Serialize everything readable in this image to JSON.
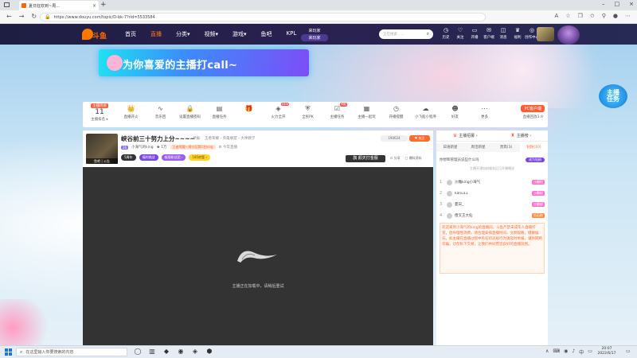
{
  "browser": {
    "tab_title": "夏日狂欢到~周...",
    "tab_close": "×",
    "new_tab": "+",
    "url": "https://www.douyu.com/topic/D-bk-7?rid=5533584",
    "window_controls": [
      "–",
      "□",
      "×"
    ]
  },
  "site": {
    "logo_text": "斗鱼",
    "nav": [
      {
        "label": "首页",
        "active": false
      },
      {
        "label": "直播",
        "active": true
      },
      {
        "label": "分类▾",
        "active": false
      },
      {
        "label": "视频▾",
        "active": false
      },
      {
        "label": "游戏▾",
        "active": false
      },
      {
        "label": "鱼吧",
        "active": false
      },
      {
        "label": "KPL",
        "active": false
      }
    ],
    "promo_top": "来玩家",
    "promo_bottom": "来玩家",
    "search_placeholder": "正在搜索……",
    "header_icons": [
      {
        "glyph": "◷",
        "label": "历史"
      },
      {
        "glyph": "♡",
        "label": "关注"
      },
      {
        "glyph": "▭",
        "label": "开播"
      },
      {
        "glyph": "✉",
        "label": "客户端"
      },
      {
        "glyph": "◫",
        "label": "消息"
      },
      {
        "glyph": "♛",
        "label": "福利"
      },
      {
        "glyph": "◎",
        "label": "创作中心"
      }
    ]
  },
  "banner": {
    "text": "为你喜爱的主播打call~"
  },
  "task_badge": {
    "line1": "主播",
    "line2": "任务"
  },
  "toolbar": {
    "rank_tag": "主播周榜",
    "rank_num": "11",
    "rank_sub": "主播排名 ▸",
    "items": [
      {
        "glyph": "👑",
        "label": "直播开火",
        "hot": ""
      },
      {
        "glyph": "∿",
        "label": "音乐回",
        "hot": ""
      },
      {
        "glyph": "🔒",
        "label": "设置直播密码",
        "hot": ""
      },
      {
        "glyph": "▤",
        "label": "直播任务",
        "hot": ""
      },
      {
        "glyph": "🎁",
        "label": "",
        "hot": ""
      },
      {
        "glyph": "◈",
        "label": "火力全开",
        "hot": "NEW"
      },
      {
        "glyph": "⛨",
        "label": "全民PK",
        "hot": ""
      },
      {
        "glyph": "☑",
        "label": "主播任务",
        "hot": "领取"
      },
      {
        "glyph": "▦",
        "label": "主播一起玩",
        "hot": ""
      },
      {
        "glyph": "◷",
        "label": "开播提醒",
        "hot": ""
      },
      {
        "glyph": "☁",
        "label": "小飞船小程序",
        "hot": ""
      },
      {
        "glyph": "☻",
        "label": "好友",
        "hot": ""
      },
      {
        "glyph": "⋯",
        "label": "更多",
        "hot": ""
      }
    ],
    "pc_button": "PC客户端",
    "pc_sub": "直播回放3.9"
  },
  "player": {
    "avatar_caption": "鱼吧 | 公告",
    "title": "峡谷前三十努力上分~~~~",
    "meta": [
      "举报",
      "王者荣耀 › 英雄联盟 › 大神教学"
    ],
    "level": "26",
    "name": "小海气的king",
    "fans": "♚ 1万",
    "rank": "王者荣耀一周分区第1名king",
    "report": "⚙ 今年直播",
    "chips": [
      "5周年",
      "福利挑战",
      "极限粉丝团 ›",
      "185房管 ›"
    ],
    "count": "190624",
    "follow": "♥ 关注",
    "gift": "旗 颜天打金服",
    "side": [
      "⊡ 分享",
      "▢ 爆料资料"
    ],
    "loading_message": "主播正在加载中，请稍后重试"
  },
  "chat": {
    "top": [
      {
        "glyph": "♛",
        "label": "主播招募 ›"
      },
      {
        "glyph": "♜",
        "label": "主播榜 ›"
      }
    ],
    "tabs": [
      {
        "label": "日语新星",
        "active": false
      },
      {
        "label": "周活新星",
        "active": false
      },
      {
        "label": "贵宾(3)",
        "active": false
      },
      {
        "label": "钻粉(10)",
        "active": true
      }
    ],
    "fan_question": "你想和管理员说些什么吗",
    "fan_button": "成为钻粉",
    "fan_note": "主播开通钻粉服务后可开播赠送",
    "rows": [
      {
        "rank": "1",
        "name": "沙雕king小海气",
        "tag": "沙雕粉"
      },
      {
        "rank": "2",
        "name": "kanu11",
        "tag": "沙雕粉"
      },
      {
        "rank": "3",
        "name": "夏日_",
        "tag": "沙雕粉"
      },
      {
        "rank": "4",
        "name": "傻叉王大仙",
        "tag": "钻石粉"
      }
    ],
    "rule": "欢迎来到小海气的king的直播间。斗鱼严禁未成年人直播打赏，倡导理性消费，请合理安排直播时间，文明观看，健康娱乐。如主播在直播过程中有任何违规行为请及时举报，谨防网络诈骗，切勿私下交易，让我们共同营造良好的直播氛围。"
  },
  "taskbar": {
    "search_placeholder": "在这里输入你要搜索的内容",
    "apps": [
      "◯",
      "▥",
      "◆",
      "◉",
      "◈",
      "⬢"
    ],
    "tray": [
      "∧",
      "⌨",
      "◉",
      "♪",
      "中",
      "▭"
    ],
    "time": "20:07",
    "date": "2022/6/17"
  }
}
